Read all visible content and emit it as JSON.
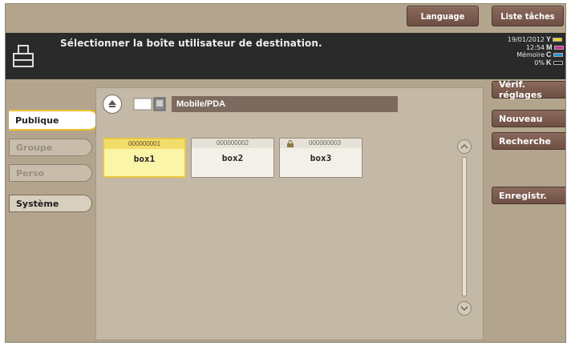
{
  "top_buttons": {
    "language": "Language",
    "jobs": "Liste tâches"
  },
  "message": "Sélectionner la boîte utilisateur de destination.",
  "status": {
    "date": "19/01/2012",
    "time": "12:54",
    "memory_label": "Mémoire",
    "memory_value": "0%"
  },
  "toner": [
    {
      "label": "Y",
      "color": "#e8d21c"
    },
    {
      "label": "M",
      "color": "#d12a8e"
    },
    {
      "label": "C",
      "color": "#2a8fd1"
    },
    {
      "label": "K",
      "color": "#1e1e1e"
    }
  ],
  "tabs": [
    "Publique",
    "Groupe",
    "Perso",
    "Système"
  ],
  "path": "Mobile/PDA",
  "boxes": [
    {
      "number": "000000001",
      "name": "box1",
      "locked": false
    },
    {
      "number": "000000002",
      "name": "box2",
      "locked": false
    },
    {
      "number": "000000003",
      "name": "box3",
      "locked": true
    }
  ],
  "right_buttons": {
    "verify": "Vérif. réglages",
    "new": "Nouveau",
    "search": "Recherche",
    "register": "Enregistr."
  }
}
